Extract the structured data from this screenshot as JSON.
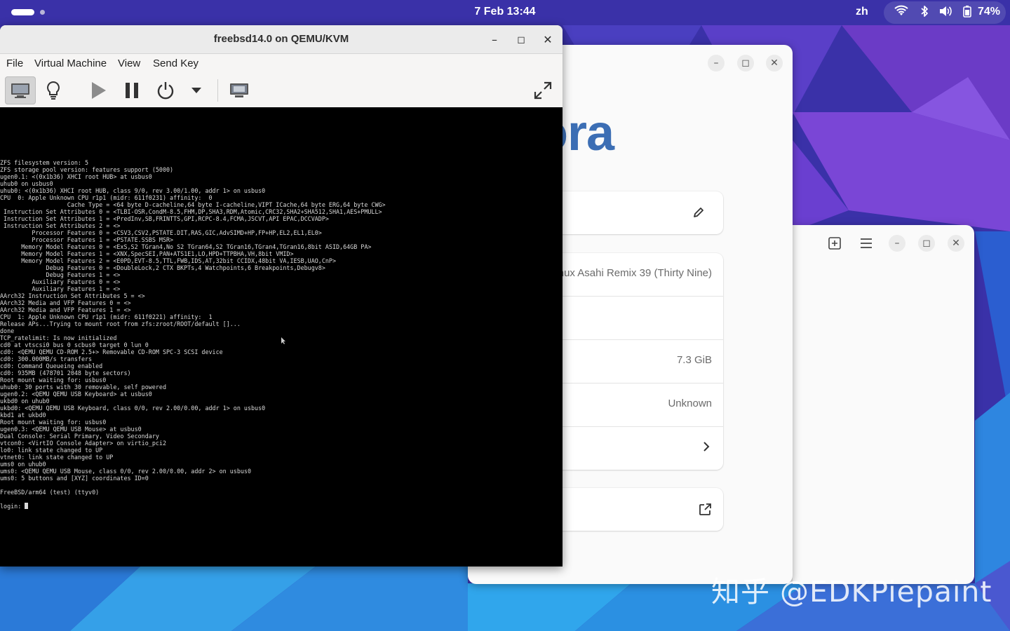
{
  "topbar": {
    "clock": "7 Feb  13:44",
    "input_language": "zh",
    "battery_percent": "74%",
    "status_icons": [
      "wifi-icon",
      "bluetooth-icon",
      "volume-icon",
      "battery-icon"
    ]
  },
  "vm_window": {
    "title": "freebsd14.0 on QEMU/KVM",
    "menu": [
      "File",
      "Virtual Machine",
      "View",
      "Send Key"
    ],
    "toolbar_icons": [
      "console-view-icon",
      "details-lightbulb-icon",
      "run-icon",
      "pause-icon",
      "shutdown-icon",
      "shutdown-dropdown-icon",
      "screenshot-icon",
      "fullscreen-icon"
    ],
    "console_lines": [
      "ZFS filesystem version: 5",
      "ZFS storage pool version: features support (5000)",
      "ugen0.1: <(0x1b36) XHCI root HUB> at usbus0",
      "uhub0 on usbus0",
      "uhub0: <(0x1b36) XHCI root HUB, class 9/0, rev 3.00/1.00, addr 1> on usbus0",
      "CPU  0: Apple Unknown CPU r1p1 (midr: 611f0231) affinity:  0",
      "                   Cache Type = <64 byte D-cacheline,64 byte I-cacheline,VIPT ICache,64 byte ERG,64 byte CWG>",
      " Instruction Set Attributes 0 = <TLBI-OSR,CondM-8.5,FHM,DP,SHA3,RDM,Atomic,CRC32,SHA2+SHA512,SHA1,AES+PMULL>",
      " Instruction Set Attributes 1 = <PredInv,SB,FRINTTS,GPI,RCPC-8.4,FCMA,JSCVT,API EPAC,DCCVADP>",
      " Instruction Set Attributes 2 = <>",
      "         Processor Features 0 = <CSV3,CSV2,PSTATE.DIT,RAS,GIC,AdvSIMD+HP,FP+HP,EL2,EL1,EL0>",
      "         Processor Features 1 = <PSTATE.SSBS MSR>",
      "      Memory Model Features 0 = <ExS,S2 TGran4,No S2 TGran64,S2 TGran16,TGran4,TGran16,8bit ASID,64GB PA>",
      "      Memory Model Features 1 = <XNX,SpecSEI,PAN+ATS1E1,LO,HPD+TTPBHA,VH,8bit VMID>",
      "      Memory Model Features 2 = <E0PD,EVT-8.5,TTL,FWB,IDS,AT,32bit CCIDX,48bit VA,IESB,UAO,CnP>",
      "             Debug Features 0 = <DoubleLock,2 CTX BKPTs,4 Watchpoints,6 Breakpoints,Debugv8>",
      "             Debug Features 1 = <>",
      "         Auxiliary Features 0 = <>",
      "         Auxiliary Features 1 = <>",
      "AArch32 Instruction Set Attributes 5 = <>",
      "AArch32 Media and VFP Features 0 = <>",
      "AArch32 Media and VFP Features 1 = <>",
      "CPU  1: Apple Unknown CPU r1p1 (midr: 611f0221) affinity:  1",
      "Release APs...Trying to mount root from zfs:zroot/ROOT/default []...",
      "done",
      "TCP_ratelimit: Is now initialized",
      "cd0 at vtscsi0 bus 0 scbus0 target 0 lun 0",
      "cd0: <QEMU QEMU CD-ROM 2.5+> Removable CD-ROM SPC-3 SCSI device",
      "cd0: 300.000MB/s transfers",
      "cd0: Command Queueing enabled",
      "cd0: 935MB (478701 2048 byte sectors)",
      "Root mount waiting for: usbus0",
      "uhub0: 30 ports with 30 removable, self powered",
      "ugen0.2: <QEMU QEMU USB Keyboard> at usbus0",
      "ukbd0 on uhub0",
      "ukbd0: <QEMU QEMU USB Keyboard, class 0/0, rev 2.00/0.00, addr 1> on usbus0",
      "kbd1 at ukbd0",
      "Root mount waiting for: usbus0",
      "ugen0.3: <QEMU QEMU USB Mouse> at usbus0",
      "Dual Console: Serial Primary, Video Secondary",
      "vtcon0: <VirtIO Console Adapter> on virtio_pci2",
      "lo0: link state changed to UP",
      "vtnet0: link state changed to UP",
      "ums0 on uhub0",
      "ums0: <QEMU QEMU USB Mouse, class 0/0, rev 2.00/0.00, addr 2> on usbus0",
      "ums0: 5 buttons and [XYZ] coordinates ID=0",
      "",
      "FreeBSD/arm64 (test) (ttyv0)",
      "",
      "login: "
    ]
  },
  "about_window": {
    "logo_text": "ora",
    "os_name": "nux Asahi Remix 39 (Thirty Nine)",
    "disk_capacity": "7.3 GiB",
    "unknown_value": "Unknown"
  },
  "watermark": "知乎 @EDKPiepaint"
}
